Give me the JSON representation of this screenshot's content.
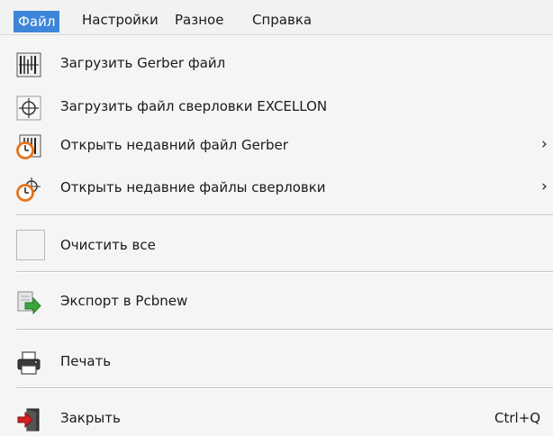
{
  "menubar": {
    "items": [
      {
        "label": "Файл"
      },
      {
        "label": "Настройки"
      },
      {
        "label": "Разное"
      },
      {
        "label": "Справка"
      }
    ]
  },
  "file_menu": {
    "items": [
      {
        "label": "Загрузить Gerber файл",
        "icon": "gerber-load-icon"
      },
      {
        "label": "Загрузить файл сверловки EXCELLON",
        "icon": "drill-target-icon"
      },
      {
        "label": "Открыть недавний файл Gerber",
        "icon": "recent-gerber-icon",
        "submenu_arrow": "›"
      },
      {
        "label": "Открыть недавние файлы сверловки",
        "icon": "recent-drill-icon",
        "submenu_arrow": "›"
      },
      {
        "label": "Очистить все",
        "icon": "clear-all-icon"
      },
      {
        "label": "Экспорт в Pcbnew",
        "icon": "export-icon"
      },
      {
        "label": "Печать",
        "icon": "printer-icon"
      },
      {
        "label": "Закрыть",
        "icon": "exit-icon",
        "shortcut": "Ctrl+Q"
      }
    ]
  },
  "colors": {
    "menubar_active": "#3c85d9",
    "clock_orange": "#e8731a",
    "export_green": "#3aa53a",
    "exit_red": "#d42020"
  }
}
